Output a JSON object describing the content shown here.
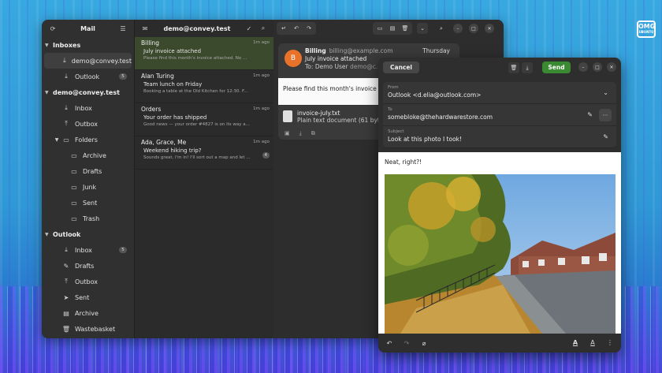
{
  "brand": {
    "logo_main": "OMG",
    "logo_sub": "UBUNTU"
  },
  "sidebar": {
    "title": "Mail",
    "groups": [
      {
        "name": "Inboxes",
        "items": [
          {
            "label": "demo@convey.test",
            "badge": ""
          },
          {
            "label": "Outlook",
            "badge": "5"
          }
        ]
      },
      {
        "name": "demo@convey.test",
        "items": [
          {
            "label": "Inbox"
          },
          {
            "label": "Outbox"
          },
          {
            "label": "Folders"
          },
          {
            "label": "Archive"
          },
          {
            "label": "Drafts"
          },
          {
            "label": "Junk"
          },
          {
            "label": "Sent"
          },
          {
            "label": "Trash"
          }
        ]
      },
      {
        "name": "Outlook",
        "items": [
          {
            "label": "Inbox",
            "badge": "5"
          },
          {
            "label": "Drafts"
          },
          {
            "label": "Outbox"
          },
          {
            "label": "Sent"
          },
          {
            "label": "Archive"
          },
          {
            "label": "Wastebasket"
          }
        ]
      }
    ]
  },
  "list": {
    "title": "demo@convey.test",
    "messages": [
      {
        "from": "Billing",
        "time": "1m ago",
        "subject": "July invoice attached",
        "preview": "Please find this month's invoice attached. No ..."
      },
      {
        "from": "Alan Turing",
        "time": "1m ago",
        "subject": "Team lunch on Friday",
        "preview": "Booking a table at the Old Kitchen for 12:30. F..."
      },
      {
        "from": "Orders",
        "time": "1m ago",
        "subject": "Your order has shipped",
        "preview": "Good news — your order #4827 is on its way a..."
      },
      {
        "from": "Ada, Grace, Me",
        "time": "1m ago",
        "subject": "Weekend hiking trip?",
        "preview": "Sounds great, I'm in! I'll sort out a map and let ...",
        "count": "4"
      }
    ]
  },
  "reader": {
    "avatar_letter": "B",
    "from": "Billing",
    "from_addr": "billing@example.com",
    "subject": "July invoice attached",
    "to_label": "To:",
    "to": "Demo User",
    "to_addr": "demo@c...",
    "date": "Thursday",
    "body": "Please find this month's invoice att... direct debit.",
    "attachment_name": "invoice-july.txt",
    "attachment_meta": "Plain text document (61 bytes)"
  },
  "compose": {
    "cancel": "Cancel",
    "send": "Send",
    "from_label": "From",
    "from_value": "Outlook <d.elia@outlook.com>",
    "to_label": "To",
    "to_value": "somebloke@thehardwarestore.com",
    "subject_label": "Subject",
    "subject_value": "Look at this photo I took!",
    "body_text": "Neat, right?!"
  }
}
